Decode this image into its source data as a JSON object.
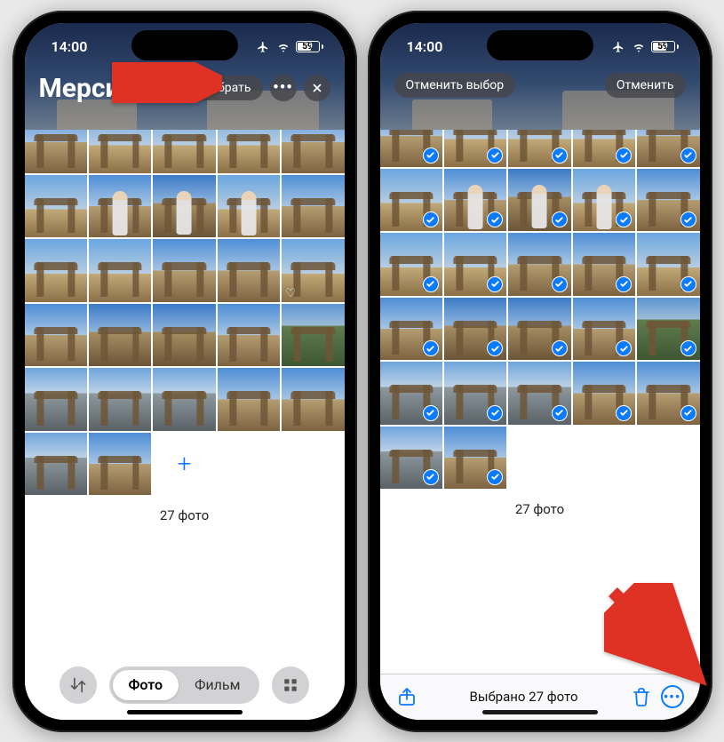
{
  "status": {
    "time": "14:00",
    "battery_pct": "59"
  },
  "phoneA": {
    "title": "Мерсин",
    "select_label": "Выбрать",
    "count_label": "27 фото",
    "seg_photo": "Фото",
    "seg_film": "Фильм",
    "cells": [
      "sky2",
      "sky1",
      "sky1",
      "sky1",
      "sky2",
      "sky1",
      "sky2",
      "sky3",
      "sky1",
      "sky2",
      "sky1",
      "sky1",
      "sky2",
      "sky2",
      "sky1",
      "sky2",
      "sky3",
      "sky3",
      "sky2",
      "green",
      "mount",
      "mount",
      "mount",
      "sky2",
      "sky2",
      "mount",
      "sky2"
    ],
    "portrait_idx": [
      6,
      7,
      8
    ],
    "fav_idx": [
      14
    ],
    "add_cell": true
  },
  "phoneB": {
    "deselect_label": "Отменить выбор",
    "cancel_label": "Отменить",
    "count_label": "27 фото",
    "selected_label": "Выбрано 27 фото",
    "cells": [
      "sky2",
      "sky1",
      "sky1",
      "sky1",
      "sky2",
      "sky1",
      "sky2",
      "sky3",
      "sky1",
      "sky2",
      "sky1",
      "sky1",
      "sky2",
      "sky2",
      "sky1",
      "sky2",
      "sky3",
      "sky3",
      "sky2",
      "green",
      "mount",
      "mount",
      "mount",
      "sky2",
      "sky2",
      "mount",
      "sky2"
    ],
    "portrait_idx": [
      6,
      7,
      8
    ]
  },
  "colors": {
    "accent": "#0a7aff",
    "arrow": "#e03224"
  }
}
